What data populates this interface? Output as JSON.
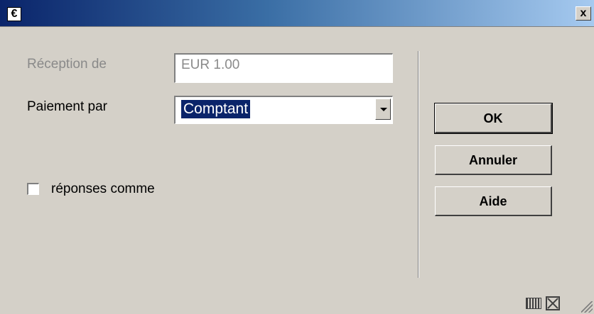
{
  "window": {
    "title_icon": "€",
    "close_glyph": "x"
  },
  "form": {
    "reception_label": "Réception de",
    "reception_value": "EUR 1.00",
    "payment_label": "Paiement par",
    "payment_value": "Comptant",
    "responses_label": "réponses comme",
    "responses_checked": false
  },
  "buttons": {
    "ok": "OK",
    "cancel": "Annuler",
    "help": "Aide"
  },
  "status_icons": [
    "keyboard-icon",
    "fullscreen-icon",
    "resize-grip-icon"
  ]
}
